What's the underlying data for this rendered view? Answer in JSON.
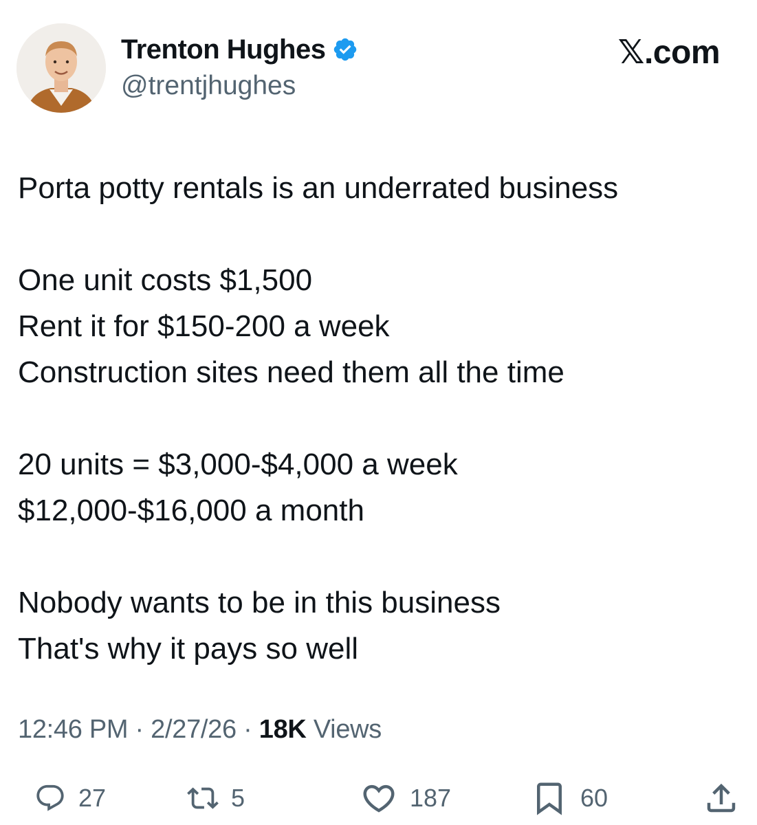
{
  "author": {
    "display_name": "Trenton Hughes",
    "handle": "@trentjhughes",
    "verified_icon": "verified-badge-icon",
    "avatar_icon": "profile-photo"
  },
  "site_label": "𝕏.com",
  "tweet": {
    "paragraphs": [
      [
        "Porta potty rentals is an underrated business"
      ],
      [
        "One unit costs $1,500",
        "Rent it for $150-200 a week",
        "Construction sites need them all the time"
      ],
      [
        "20 units = $3,000-$4,000 a week",
        "$12,000-$16,000 a month"
      ],
      [
        "Nobody wants to be in this business",
        "That's why it pays so well"
      ]
    ]
  },
  "meta": {
    "time": "12:46 PM",
    "separator": "·",
    "date": "2/27/26",
    "views_count": "18K",
    "views_label": "Views"
  },
  "actions": {
    "replies": "27",
    "reposts": "5",
    "likes": "187",
    "bookmarks": "60"
  },
  "colors": {
    "text": "#0f1419",
    "secondary": "#536471",
    "verified": "#1d9bf0",
    "background": "#ffffff"
  }
}
